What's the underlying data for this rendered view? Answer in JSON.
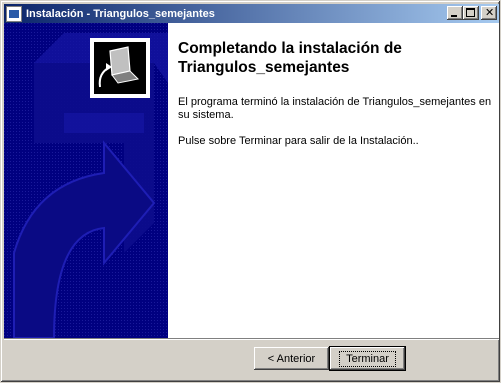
{
  "window": {
    "title": "Instalación - Triangulos_semejantes",
    "buttons": {
      "minimize": "minimize",
      "maximize": "maximize",
      "close": "close"
    }
  },
  "sidebar": {
    "image": "setup-computer-icon",
    "background": "#000080"
  },
  "content": {
    "heading": "Completando la instalación de Triangulos_semejantes",
    "paragraph1": "El programa terminó la instalación de Triangulos_semejantes en su sistema.",
    "paragraph2": "Pulse sobre Terminar para salir de la Instalación.."
  },
  "footer": {
    "back_label": "< Anterior",
    "finish_label": "Terminar"
  },
  "colors": {
    "titlebar_start": "#0a246a",
    "titlebar_end": "#a6caf0",
    "sidebar": "#000080"
  }
}
